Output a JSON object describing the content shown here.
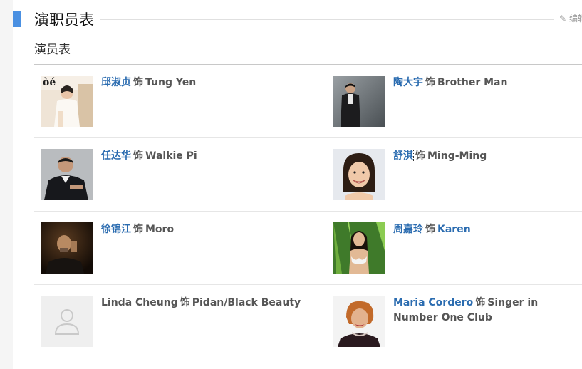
{
  "section": {
    "title": "演职员表",
    "edit_label": "编辑",
    "subtitle": "演员表"
  },
  "cast": [
    {
      "actor": "邱淑贞",
      "as_word": "饰",
      "role": "Tung Yen",
      "photo_icon": "actor-photo"
    },
    {
      "actor": "陶大宇",
      "as_word": "饰",
      "role": "Brother Man",
      "photo_icon": "actor-photo"
    },
    {
      "actor": "任达华",
      "as_word": "饰",
      "role": "Walkie Pi",
      "photo_icon": "actor-photo"
    },
    {
      "actor": "舒淇",
      "as_word": "饰",
      "role": "Ming-Ming",
      "photo_icon": "actor-photo"
    },
    {
      "actor": "徐锦江",
      "as_word": "饰",
      "role": "Moro",
      "photo_icon": "actor-photo"
    },
    {
      "actor": "周嘉玲",
      "as_word": "饰",
      "role": "Karen",
      "photo_icon": "actor-photo"
    },
    {
      "actor": "Linda Cheung",
      "as_word": "饰",
      "role": "Pidan/Black Beauty",
      "photo_icon": "default-avatar-icon"
    },
    {
      "actor": "Maria Cordero",
      "as_word": "饰",
      "role": "Singer in Number One Club",
      "photo_icon": "actor-photo"
    }
  ],
  "colors": {
    "accent": "#4a90e2",
    "link": "#2b6cb0",
    "text": "#555555"
  }
}
